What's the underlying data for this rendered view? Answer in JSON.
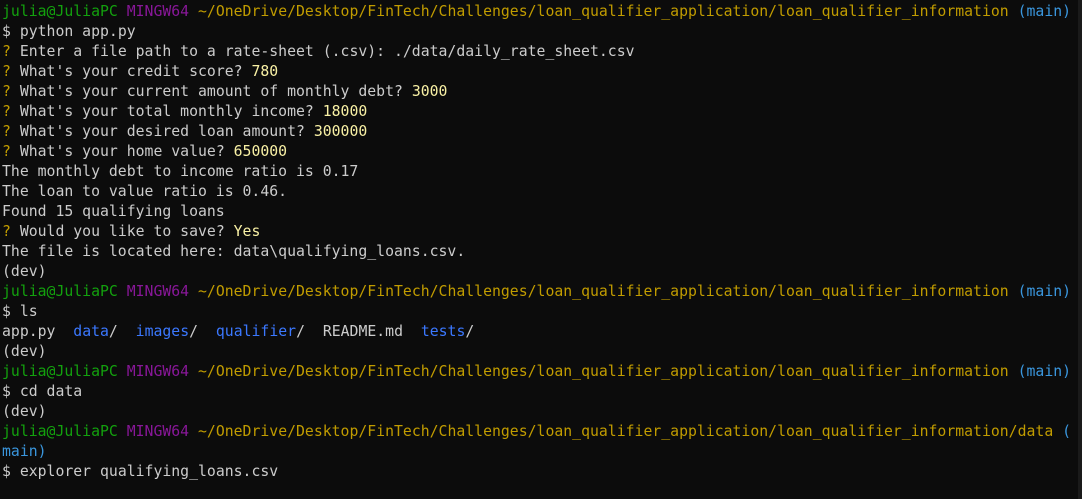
{
  "prompt": {
    "user": "julia@JuliaPC",
    "system": "MINGW64",
    "path": "~/OneDrive/Desktop/FinTech/Challenges/loan_qualifier_application/loan_qualifier_information",
    "branch": "(main)",
    "dollar": "$ "
  },
  "session": {
    "cmd1": "python app.py",
    "q_mark": "? ",
    "q1": "Enter a file path to a rate-sheet (.csv): ",
    "a1": "./data/daily_rate_sheet.csv",
    "q2": "What's your credit score? ",
    "a2": "780",
    "q3": "What's your current amount of monthly debt? ",
    "a3": "3000",
    "q4": "What's your total monthly income? ",
    "a4": "18000",
    "q5": "What's your desired loan amount? ",
    "a5": "300000",
    "q6": "What's your home value? ",
    "a6": "650000",
    "out1": "The monthly debt to income ratio is 0.17",
    "out2": "The loan to value ratio is 0.46.",
    "out3": "Found 15 qualifying loans",
    "q7": "Would you like to save? ",
    "a7": "Yes",
    "out4": "The file is located here: data\\qualifying_loans.csv.",
    "env": "(dev)",
    "cmd2": "ls",
    "ls": {
      "f1": "app.py",
      "d1": "data",
      "d2": "images",
      "d3": "qualifier",
      "f2": "README.md",
      "d4": "tests",
      "slash": "/"
    },
    "cmd3": "cd data",
    "path_data": "~/OneDrive/Desktop/FinTech/Challenges/loan_qualifier_application/loan_qualifier_information/data",
    "branch_open": "(",
    "branch_close": "main)",
    "cmd4": "explorer qualifying_loans.csv"
  }
}
